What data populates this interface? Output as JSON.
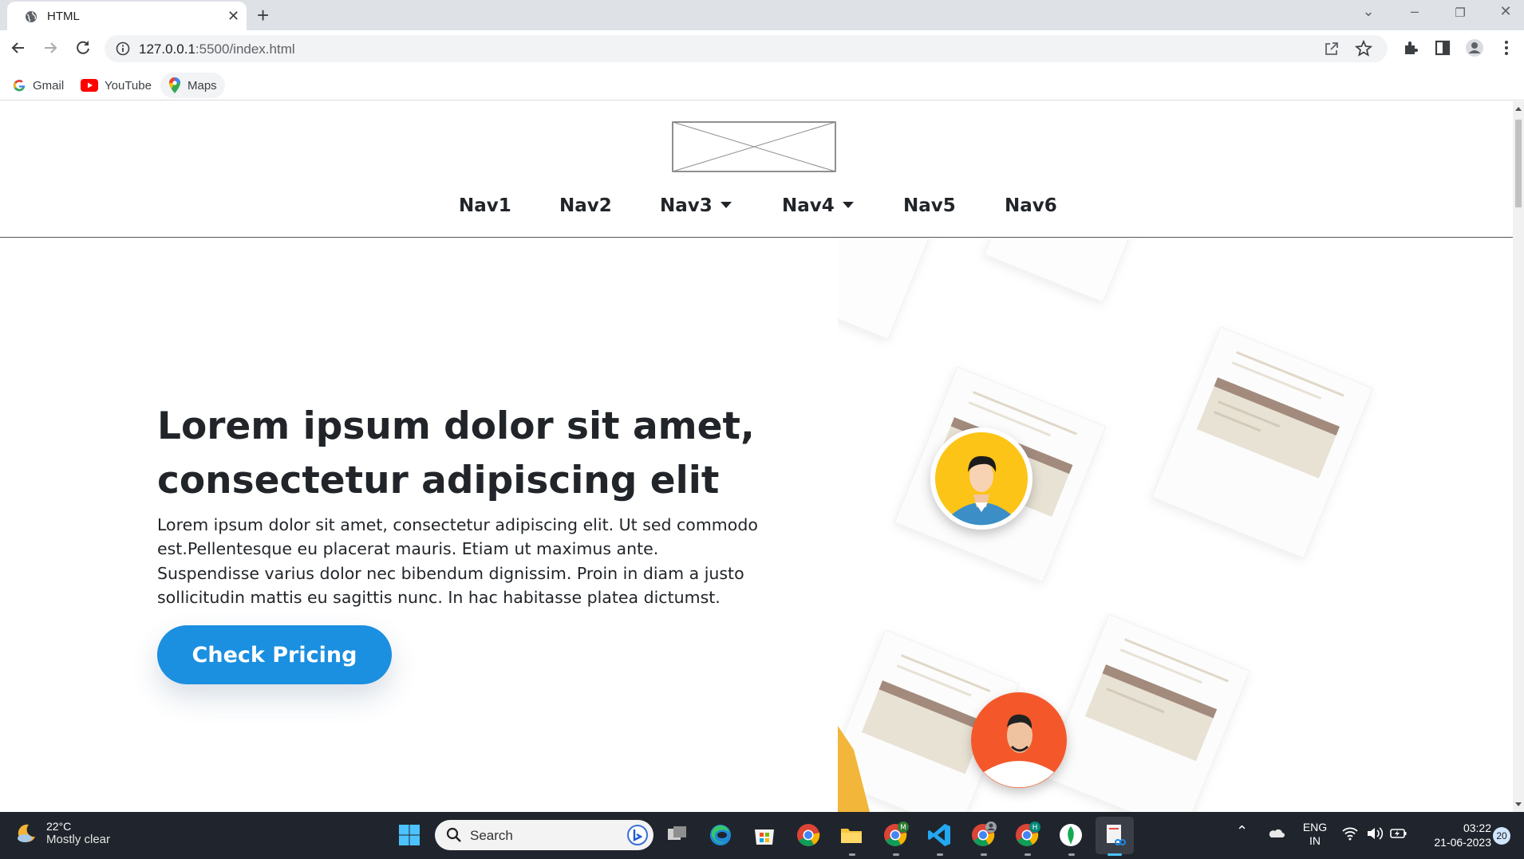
{
  "browser": {
    "tab_title": "HTML",
    "url_host": "127.0.0.1",
    "url_path": ":5500/index.html",
    "bookmarks": [
      {
        "label": "Gmail"
      },
      {
        "label": "YouTube"
      },
      {
        "label": "Maps"
      }
    ]
  },
  "site": {
    "nav": [
      {
        "label": "Nav1",
        "dropdown": false
      },
      {
        "label": "Nav2",
        "dropdown": false
      },
      {
        "label": "Nav3",
        "dropdown": true
      },
      {
        "label": "Nav4",
        "dropdown": true
      },
      {
        "label": "Nav5",
        "dropdown": false
      },
      {
        "label": "Nav6",
        "dropdown": false
      }
    ],
    "hero": {
      "title_line1": "Lorem ipsum dolor sit amet,",
      "title_line2": "consectetur adipiscing elit",
      "text": "Lorem ipsum dolor sit amet, consectetur adipiscing elit. Ut sed commodo est.Pellentesque eu placerat mauris. Etiam ut maximus ante. Suspendisse varius dolor nec bibendum dignissim. Proin in diam a justo sollicitudin mattis eu sagittis nunc. In hac habitasse platea dictumst.",
      "cta_label": "Check Pricing"
    }
  },
  "taskbar": {
    "weather_temp": "22°C",
    "weather_desc": "Mostly clear",
    "search_label": "Search",
    "lang_line1": "ENG",
    "lang_line2": "IN",
    "time": "03:22",
    "date": "21-06-2023",
    "notification_count": "20",
    "badge_m": "M",
    "badge_h": "H"
  },
  "colors": {
    "accent": "#1b8fe0",
    "taskbar": "#20252d",
    "avatar_yellow": "#fcc417",
    "avatar_orange": "#f4592a"
  }
}
